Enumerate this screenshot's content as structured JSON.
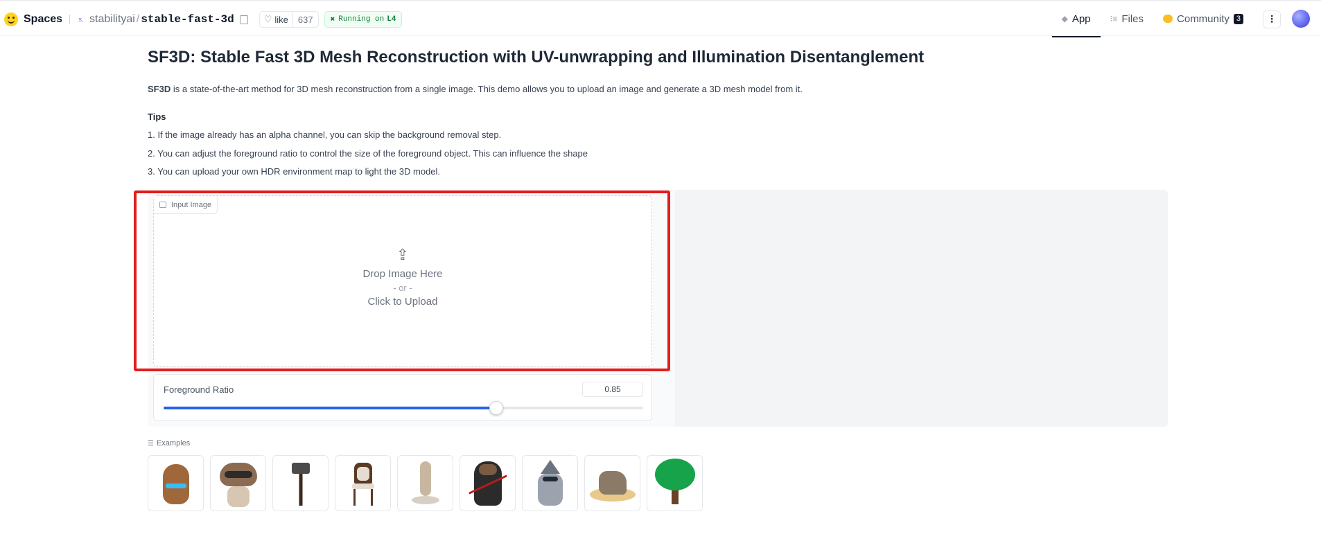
{
  "header": {
    "spaces_label": "Spaces",
    "org": "stabilityai",
    "repo": "stable-fast-3d",
    "like_label": "like",
    "like_count": "637",
    "running_label": "Running on",
    "hardware": "L4",
    "tabs": [
      {
        "label": "App",
        "active": true
      },
      {
        "label": "Files",
        "active": false
      },
      {
        "label": "Community",
        "active": false,
        "count": "3"
      }
    ]
  },
  "main": {
    "title": "SF3D: Stable Fast 3D Mesh Reconstruction with UV-unwrapping and Illumination Disentanglement",
    "desc_bold": "SF3D",
    "desc_rest": " is a state-of-the-art method for 3D mesh reconstruction from a single image. This demo allows you to upload an image and generate a 3D mesh model from it.",
    "tips_heading": "Tips",
    "tips": [
      "1. If the image already has an alpha channel, you can skip the background removal step.",
      "2. You can adjust the foreground ratio to control the size of the foreground object. This can influence the shape",
      "3. You can upload your own HDR environment map to light the 3D model."
    ]
  },
  "upload": {
    "label": "Input Image",
    "drop_text": "Drop Image Here",
    "or_text": "- or -",
    "click_text": "Click to Upload"
  },
  "slider": {
    "label": "Foreground Ratio",
    "value": "0.85",
    "fraction": 0.694
  },
  "examples": {
    "heading": "Examples",
    "items": [
      "beaver-example",
      "raccoon-example",
      "axe-example",
      "chair-example",
      "statue-example",
      "otter-samurai-example",
      "raccoon-wizard-example",
      "rocks-example",
      "tree-example"
    ]
  },
  "colors": {
    "accent": "#2563eb",
    "highlight": "#e11d1d",
    "running_green": "#15803d"
  }
}
